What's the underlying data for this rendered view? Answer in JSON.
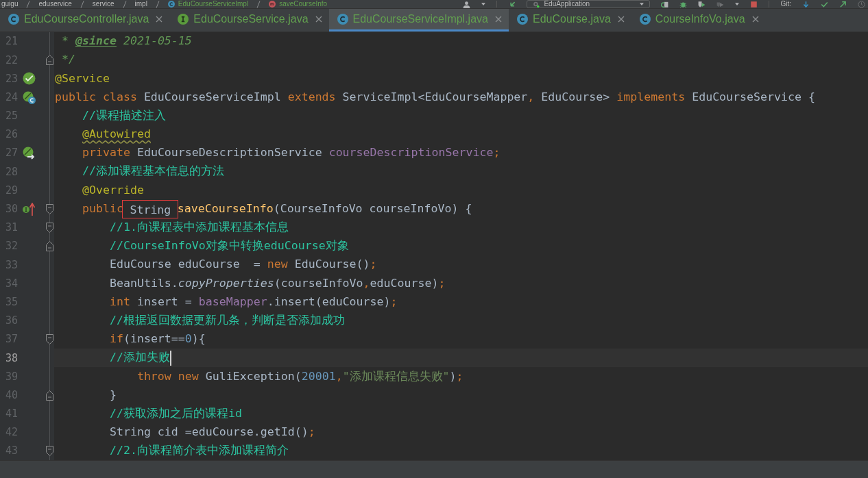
{
  "toolbar": {
    "breadcrumbs": [
      {
        "label": "guigu",
        "kind": "folder"
      },
      {
        "label": "eduservice",
        "kind": "folder"
      },
      {
        "label": "service",
        "kind": "folder"
      },
      {
        "label": "impl",
        "kind": "folder"
      },
      {
        "label": "EduCourseServiceImpl",
        "kind": "class"
      },
      {
        "label": "saveCourseInfo",
        "kind": "method"
      }
    ],
    "run_configuration": "EduApplication",
    "vcs_label": "Git:"
  },
  "tabs": [
    {
      "label": "EduCourseController.java",
      "kind": "class",
      "selected": false
    },
    {
      "label": "EduCourseService.java",
      "kind": "interface",
      "selected": false
    },
    {
      "label": "EduCourseServiceImpl.java",
      "kind": "class",
      "selected": true
    },
    {
      "label": "EduCourse.java",
      "kind": "class",
      "selected": false
    },
    {
      "label": "CourseInfoVo.java",
      "kind": "class",
      "selected": false
    }
  ],
  "editor": {
    "lines": [
      {
        "number": "21",
        "current": false,
        "tokens": [
          {
            "kind": "doc",
            "text": " * "
          },
          {
            "kind": "doctag",
            "text": "@since"
          },
          {
            "kind": "doc",
            "text": " 2021-05-15"
          }
        ]
      },
      {
        "number": "22",
        "current": false,
        "fold": {
          "kind": "end"
        },
        "tokens": [
          {
            "kind": "doc",
            "text": " */"
          }
        ]
      },
      {
        "number": "23",
        "current": false,
        "gutter_icon": {
          "kind": "bean"
        },
        "tokens": [
          {
            "kind": "annotation",
            "text": "@Service"
          }
        ]
      },
      {
        "number": "24",
        "current": false,
        "gutter_icon": {
          "kind": "bean-class"
        },
        "tokens": [
          {
            "kind": "keyword",
            "text": "public class "
          },
          {
            "kind": "plain",
            "text": "EduCourseServiceImpl "
          },
          {
            "kind": "keyword",
            "text": "extends "
          },
          {
            "kind": "plain",
            "text": "ServiceImpl<EduCourseMapper"
          },
          {
            "kind": "separator",
            "text": ","
          },
          {
            "kind": "plain",
            "text": " EduCourse> "
          },
          {
            "kind": "keyword",
            "text": "implements "
          },
          {
            "kind": "plain",
            "text": "EduCourseService {"
          }
        ]
      },
      {
        "number": "25",
        "current": false,
        "tokens": [
          {
            "kind": "comment",
            "text": "    //课程描述注入"
          }
        ]
      },
      {
        "number": "26",
        "current": false,
        "tokens": [
          {
            "kind": "annotation-warn",
            "text": "    @Autowired"
          }
        ]
      },
      {
        "number": "27",
        "current": false,
        "gutter_icon": {
          "kind": "bean-link"
        },
        "tokens": [
          {
            "kind": "keyword",
            "text": "    private "
          },
          {
            "kind": "plain",
            "text": "EduCourseDescriptionService "
          },
          {
            "kind": "field",
            "text": "courseDescriptionService"
          },
          {
            "kind": "separator",
            "text": ";"
          }
        ]
      },
      {
        "number": "28",
        "current": false,
        "tokens": [
          {
            "kind": "comment",
            "text": "    //添加课程基本信息的方法"
          }
        ]
      },
      {
        "number": "29",
        "current": false,
        "tokens": [
          {
            "kind": "annotation",
            "text": "    @Override"
          }
        ]
      },
      {
        "number": "30",
        "current": false,
        "gutter_icon": {
          "kind": "implements"
        },
        "fold": {
          "kind": "start"
        },
        "tokens": [
          {
            "kind": "keyword",
            "text": "    public"
          },
          {
            "kind": "boxed",
            "text": " String "
          },
          {
            "kind": "method",
            "text": "saveCourseInfo"
          },
          {
            "kind": "plain",
            "text": "(CourseInfoVo courseInfoVo) {"
          }
        ]
      },
      {
        "number": "31",
        "current": false,
        "fold": {
          "kind": "start"
        },
        "tokens": [
          {
            "kind": "comment",
            "text": "        //1.向课程表中添加课程基本信息"
          }
        ]
      },
      {
        "number": "32",
        "current": false,
        "fold": {
          "kind": "end"
        },
        "tokens": [
          {
            "kind": "comment",
            "text": "        //CourseInfoVo对象中转换eduCourse对象"
          }
        ]
      },
      {
        "number": "33",
        "current": false,
        "tokens": [
          {
            "kind": "plain",
            "text": "        EduCourse eduCourse  = "
          },
          {
            "kind": "keyword",
            "text": "new "
          },
          {
            "kind": "plain",
            "text": "EduCourse()"
          },
          {
            "kind": "separator",
            "text": ";"
          }
        ]
      },
      {
        "number": "34",
        "current": false,
        "tokens": [
          {
            "kind": "plain",
            "text": "        BeanUtils."
          },
          {
            "kind": "static",
            "text": "copyProperties"
          },
          {
            "kind": "plain",
            "text": "(courseInfoVo"
          },
          {
            "kind": "separator",
            "text": ","
          },
          {
            "kind": "plain",
            "text": "eduCourse)"
          },
          {
            "kind": "separator",
            "text": ";"
          }
        ]
      },
      {
        "number": "35",
        "current": false,
        "tokens": [
          {
            "kind": "keyword",
            "text": "        int "
          },
          {
            "kind": "plain",
            "text": "insert = "
          },
          {
            "kind": "field",
            "text": "baseMapper"
          },
          {
            "kind": "plain",
            "text": ".insert(eduCourse)"
          },
          {
            "kind": "separator",
            "text": ";"
          }
        ]
      },
      {
        "number": "36",
        "current": false,
        "tokens": [
          {
            "kind": "comment",
            "text": "        //根据返回数据更新几条，判断是否添加成功"
          }
        ]
      },
      {
        "number": "37",
        "current": false,
        "fold": {
          "kind": "start"
        },
        "tokens": [
          {
            "kind": "keyword",
            "text": "        if"
          },
          {
            "kind": "plain",
            "text": "(insert=="
          },
          {
            "kind": "number",
            "text": "0"
          },
          {
            "kind": "plain",
            "text": "){"
          }
        ]
      },
      {
        "number": "38",
        "current": true,
        "tokens": [
          {
            "kind": "comment",
            "text": "        //添加失败"
          }
        ]
      },
      {
        "number": "39",
        "current": false,
        "tokens": [
          {
            "kind": "keyword",
            "text": "            throw new "
          },
          {
            "kind": "plain",
            "text": "GuliException("
          },
          {
            "kind": "number",
            "text": "20001"
          },
          {
            "kind": "separator",
            "text": ","
          },
          {
            "kind": "string",
            "text": "\"添加课程信息失败\""
          },
          {
            "kind": "plain",
            "text": ")"
          },
          {
            "kind": "separator",
            "text": ";"
          }
        ]
      },
      {
        "number": "40",
        "current": false,
        "fold": {
          "kind": "end"
        },
        "tokens": [
          {
            "kind": "plain",
            "text": "        }"
          }
        ]
      },
      {
        "number": "41",
        "current": false,
        "tokens": [
          {
            "kind": "comment",
            "text": "        //获取添加之后的课程id"
          }
        ]
      },
      {
        "number": "42",
        "current": false,
        "tokens": [
          {
            "kind": "plain",
            "text": "        String cid =eduCourse.getId()"
          },
          {
            "kind": "separator",
            "text": ";"
          }
        ]
      },
      {
        "number": "43",
        "current": false,
        "fold": {
          "kind": "start"
        },
        "tokens": [
          {
            "kind": "comment",
            "text": "        //2.向课程简介表中添加课程简介"
          }
        ]
      }
    ]
  }
}
